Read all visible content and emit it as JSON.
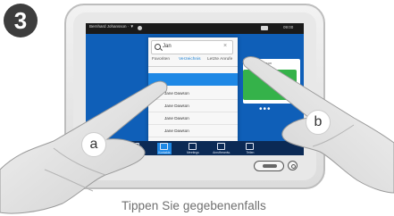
{
  "step_number": "3",
  "status_bar": {
    "user": "Bernhard Johansson · ▼",
    "time": "09:00"
  },
  "search": {
    "value": "Jan"
  },
  "tabs": [
    {
      "label": "Favoriten",
      "active": false
    },
    {
      "label": "Verzeichnis",
      "active": true
    },
    {
      "label": "Letzte Anrufe",
      "active": false
    }
  ],
  "list": {
    "hint": "",
    "rows": [
      "Jane Dawson",
      "Jane Dawson",
      "Jane Dawson",
      "Jane Dawson",
      "Jane Dawson"
    ]
  },
  "card": {
    "title": "Jane Dawson"
  },
  "dock": [
    {
      "label": "",
      "icon": "grid-icon"
    },
    {
      "label": "Kontakte",
      "icon": "contacts-icon",
      "selected": true
    },
    {
      "label": "Meetings",
      "icon": "calendar-icon"
    },
    {
      "label": "Anrufbeantw.",
      "icon": "voicemail-icon"
    },
    {
      "label": "Teilen",
      "icon": "share-icon"
    }
  ],
  "hands": {
    "left_label": "a",
    "right_label": "b"
  },
  "caption": "Tippen Sie gegebenenfalls",
  "colors": {
    "screen_bg": "#0f5fb8",
    "selected_row": "#1e88e5",
    "card_green": "#35b24a",
    "dock_bg": "#0b2a55"
  }
}
